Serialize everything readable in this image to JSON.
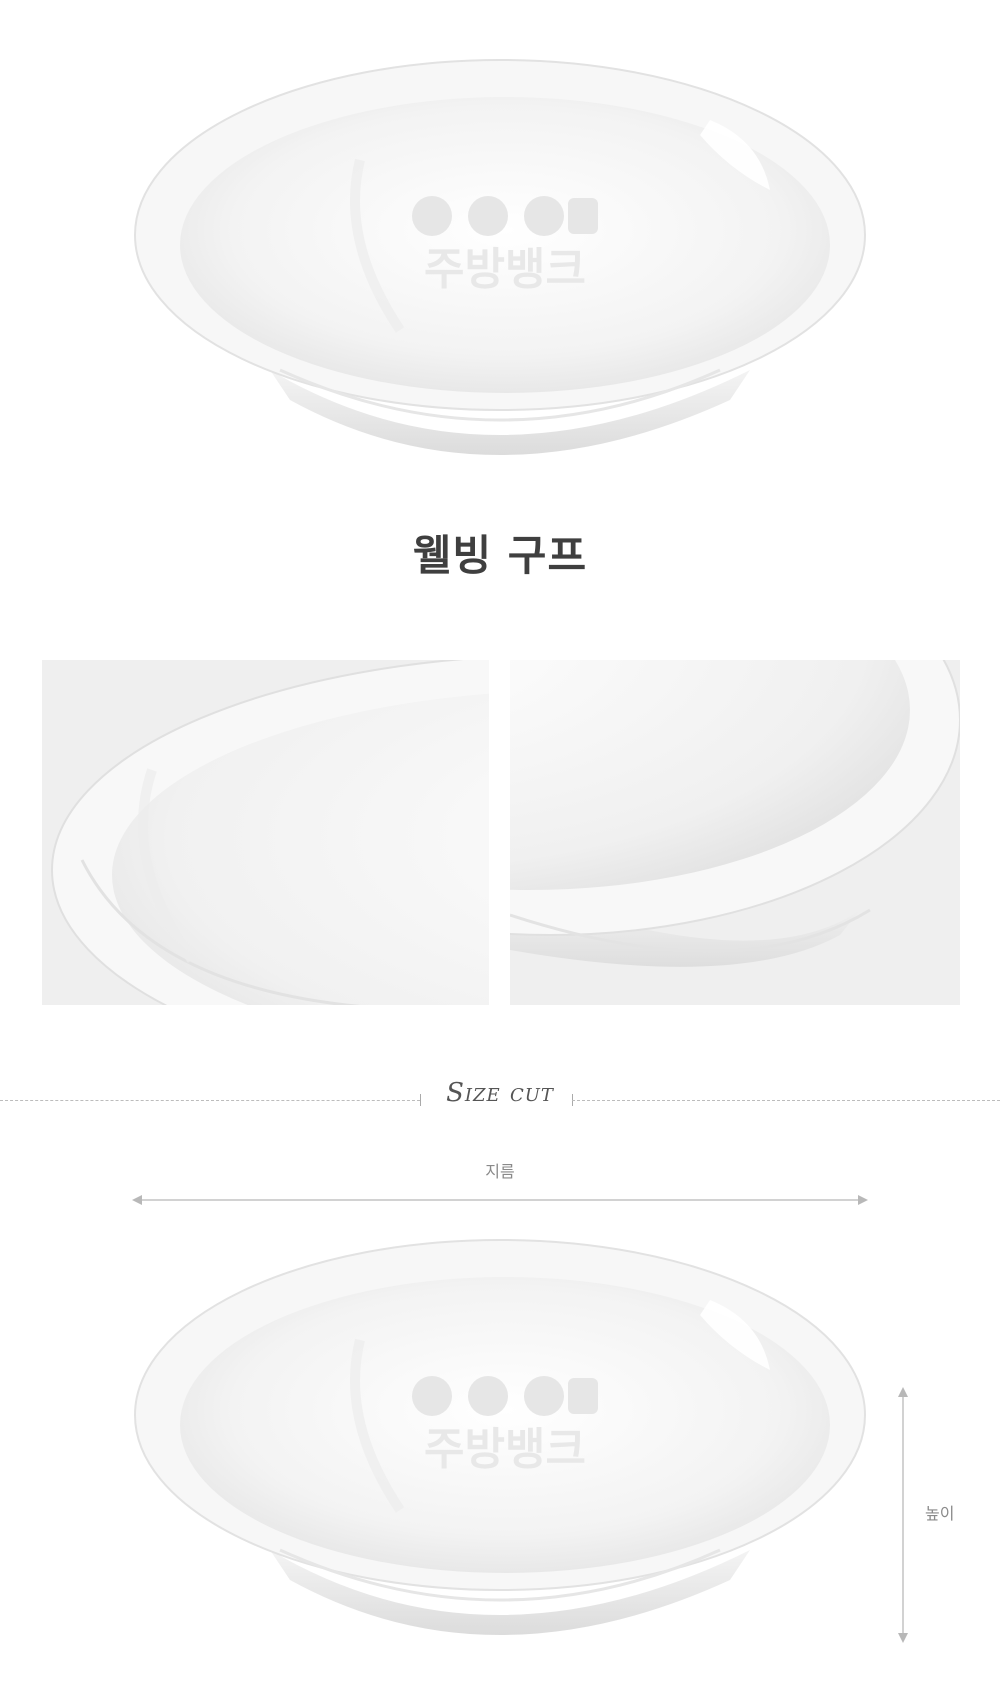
{
  "product": {
    "title": "웰빙 구프"
  },
  "watermark": {
    "text": "주방뱅크"
  },
  "size_section": {
    "label": "Size cut",
    "width_label": "지름",
    "height_label": "높이"
  },
  "colors": {
    "title": "#3f3f3f",
    "divider": "#bcbcbc",
    "dimension": "#8a8a8a",
    "photo_background": "#efefef"
  }
}
